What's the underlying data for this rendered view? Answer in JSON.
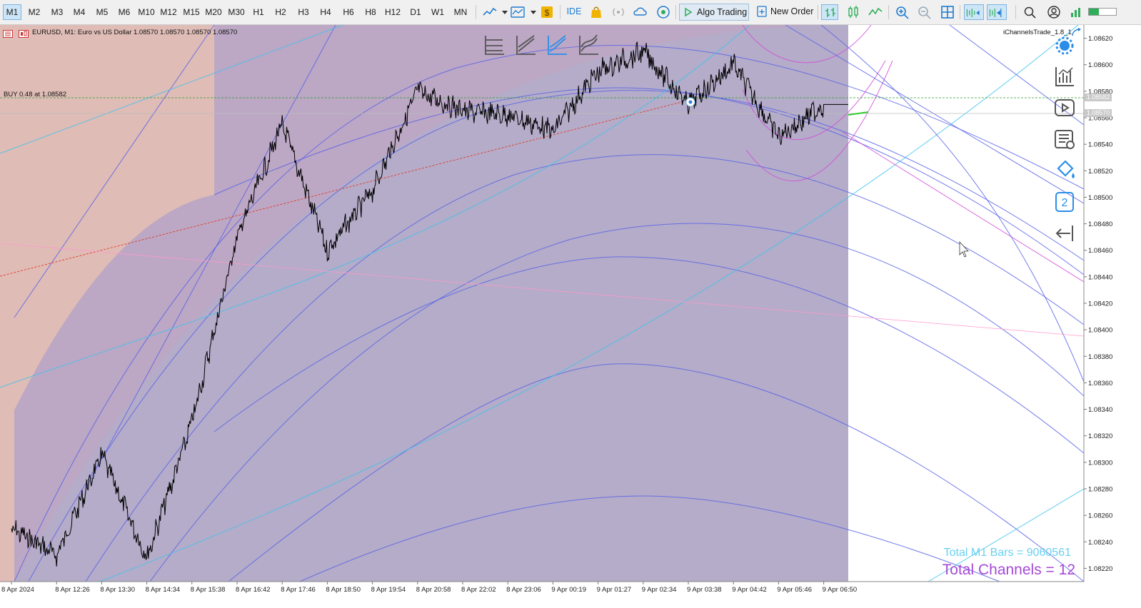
{
  "toolbar": {
    "timeframes": [
      "M1",
      "M2",
      "M3",
      "M4",
      "M5",
      "M6",
      "M10",
      "M12",
      "M15",
      "M20",
      "M30",
      "H1",
      "H2",
      "H3",
      "H4",
      "H6",
      "H8",
      "H12",
      "D1",
      "W1",
      "MN"
    ],
    "active_timeframe": "M1",
    "ide_label": "IDE",
    "algo_trading_label": "Algo Trading",
    "new_order_label": "New Order",
    "accent": "#1e7bd0"
  },
  "chart": {
    "header_text": "EURUSD, M1:  Euro vs US Dollar  1.08570 1.08570 1.08570 1.08570",
    "indicator_name": "iChannelsTrade_1.8_1",
    "position_label": "BUY 0.48 at 1.08582",
    "ask_price": "1.08582",
    "bid_price": "1.08570",
    "total_bars_text": "Total M1 Bars = 9060561",
    "total_channels_text": "Total Channels = 12",
    "price_ticks": [
      "1.08620",
      "1.08600",
      "1.08580",
      "1.08560",
      "1.08540",
      "1.08520",
      "1.08500",
      "1.08480",
      "1.08460",
      "1.08440",
      "1.08420",
      "1.08400",
      "1.08380",
      "1.08360",
      "1.08340",
      "1.08320",
      "1.08300",
      "1.08280",
      "1.08260",
      "1.08240",
      "1.08220"
    ],
    "time_ticks": [
      "8 Apr 2024",
      "8 Apr 12:26",
      "8 Apr 13:30",
      "8 Apr 14:34",
      "8 Apr 15:38",
      "8 Apr 16:42",
      "8 Apr 17:46",
      "8 Apr 18:50",
      "8 Apr 19:54",
      "8 Apr 20:58",
      "8 Apr 22:02",
      "8 Apr 23:06",
      "9 Apr 00:19",
      "9 Apr 01:27",
      "9 Apr 02:34",
      "9 Apr 03:38",
      "9 Apr 04:42",
      "9 Apr 05:46",
      "9 Apr 06:50"
    ],
    "colors": {
      "background_left": "#dcbcb6",
      "channel_fill": "#9b8fd6",
      "channel_line": "#5b63e8",
      "aux_line": "#3fc3ee",
      "magenta_line": "#d24bd8",
      "candle": "#000000",
      "bars_text": "#6ad0f0",
      "channels_text": "#a64ad6"
    }
  },
  "chart_data": {
    "type": "line",
    "title": "",
    "symbol": "EURUSD",
    "timeframe": "M1",
    "x": [
      "8 Apr 2024",
      "8 Apr 12:26",
      "8 Apr 13:30",
      "8 Apr 14:34",
      "8 Apr 15:38",
      "8 Apr 16:42",
      "8 Apr 17:46",
      "8 Apr 18:50",
      "8 Apr 19:54",
      "8 Apr 20:58",
      "8 Apr 22:02",
      "8 Apr 23:06",
      "9 Apr 00:19",
      "9 Apr 01:27",
      "9 Apr 02:34",
      "9 Apr 03:38",
      "9 Apr 04:42",
      "9 Apr 05:46",
      "9 Apr 06:50"
    ],
    "series": [
      {
        "values": [
          1.0825,
          1.0823,
          1.08305,
          1.08228,
          1.0833,
          1.0847,
          1.08555,
          1.0846,
          1.08505,
          1.0858,
          1.08565,
          1.08562,
          1.0855,
          1.08595,
          1.0861,
          1.0857,
          1.086,
          1.08545,
          1.0857
        ]
      }
    ],
    "ylim": [
      1.0821,
      1.0863
    ],
    "grid": false,
    "xlabel": "",
    "ylabel": ""
  }
}
